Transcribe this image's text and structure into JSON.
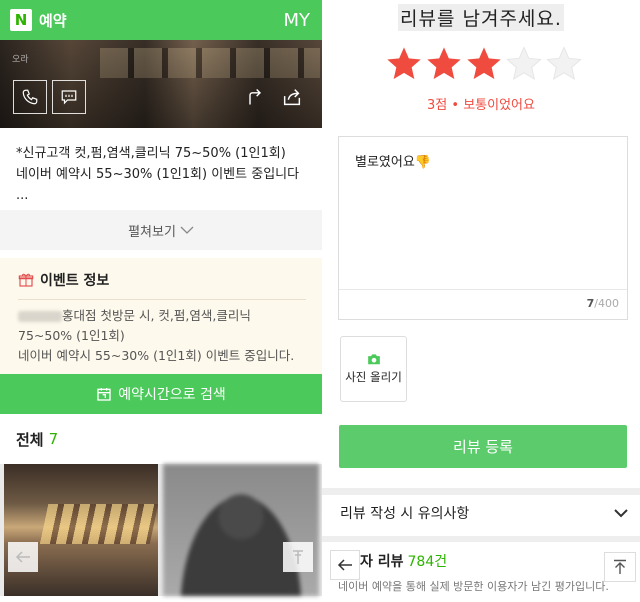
{
  "left": {
    "topbar": {
      "logo": "N",
      "title": "예약",
      "my_label": "MY"
    },
    "hero": {
      "tiny_text": "오라"
    },
    "description": {
      "line1": "*신규고객 컷,펌,염색,클리닉 75~50% (1인1회)",
      "line2": "네이버 예약시 55~30% (1인1회) 이벤트 중입니다",
      "line3": "..."
    },
    "expand_label": "펼쳐보기",
    "event": {
      "title": "이벤트 정보",
      "line1_blurred_prefix": "ARBOR",
      "line1": "홍대점 첫방문 시, 컷,펌,염색,클리닉",
      "line2": "75~50% (1인1회)",
      "line3": "네이버 예약시 55~30% (1인1회) 이벤트 중입니다."
    },
    "search_button": "예약시간으로 검색",
    "count": {
      "label": "전체",
      "value": "7"
    }
  },
  "right": {
    "title": "리뷰를 남겨주세요.",
    "rating": {
      "filled": 3,
      "total": 5,
      "text": "3점 • 보통이었어요"
    },
    "review": {
      "text": "별로였어요👎",
      "count": "7",
      "max": "/400"
    },
    "photo_button": "사진 올리기",
    "submit_button": "리뷰 등록",
    "notice_label": "리뷰 작성 시 유의사항",
    "visitor": {
      "label": "자 리뷰",
      "count": "784건",
      "sub": "네이버 예약을 통해 실제 방문한 이용자가 남긴 평가입니다."
    }
  },
  "colors": {
    "green": "#4cc95b",
    "star_red": "#f04b3f",
    "star_empty": "#eeeeee"
  }
}
